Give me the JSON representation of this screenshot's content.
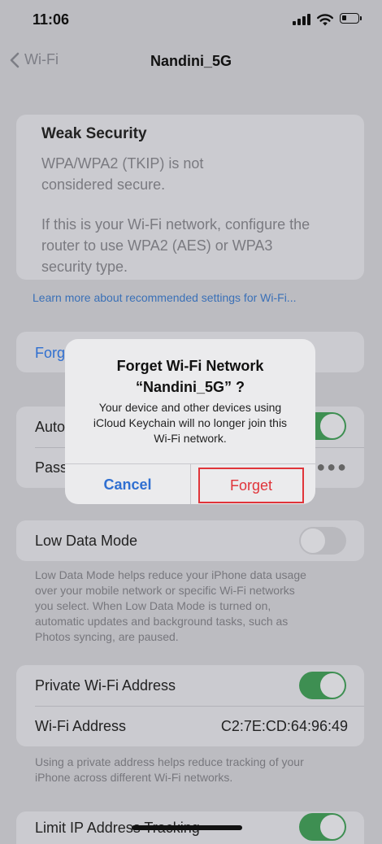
{
  "status": {
    "time": "11:06"
  },
  "nav": {
    "back_label": "Wi-Fi",
    "title": "Nandini_5G"
  },
  "warning": {
    "title": "Weak Security",
    "line1": "WPA/WPA2 (TKIP) is not",
    "line2": "considered secure.",
    "line3": "If this is your Wi-Fi network, configure the",
    "line4": "router to use WPA2 (AES) or WPA3",
    "line5": "security type."
  },
  "learn_more": "Learn more about recommended settings for Wi-Fi...",
  "forget_row": {
    "label": "Forg"
  },
  "auto_row": {
    "label": "Auto",
    "toggle_on": true
  },
  "pass_row": {
    "label": "Pass",
    "value": "●●●"
  },
  "low_data": {
    "label": "Low Data Mode",
    "toggle_on": false,
    "note1": "Low Data Mode helps reduce your iPhone data usage",
    "note2": "over your mobile network or specific Wi-Fi networks",
    "note3": "you select. When Low Data Mode is turned on,",
    "note4": "automatic updates and background tasks, such as",
    "note5": "Photos syncing, are paused."
  },
  "private": {
    "label": "Private Wi-Fi Address",
    "toggle_on": true,
    "addr_label": "Wi-Fi Address",
    "addr_value": "C2:7E:CD:64:96:49",
    "note1": "Using a private address helps reduce tracking of your",
    "note2": "iPhone across different Wi-Fi networks."
  },
  "limit_ip": {
    "label": "Limit IP Address Tracking",
    "toggle_on": true
  },
  "alert": {
    "title1": "Forget Wi-Fi Network",
    "title2": "“Nandini_5G” ?",
    "msg1": "Your device and other devices using",
    "msg2": "iCloud Keychain will no longer join this",
    "msg3": "Wi-Fi network.",
    "cancel_label": "Cancel",
    "forget_label": "Forget"
  },
  "colors": {
    "accent": "#2f6fd1",
    "destructive": "#e0343a",
    "toggle_on": "#3e8f52"
  }
}
